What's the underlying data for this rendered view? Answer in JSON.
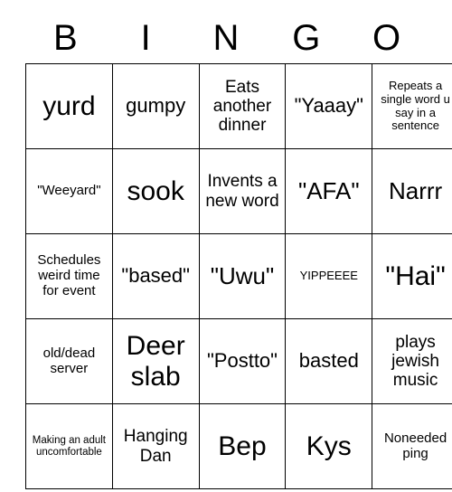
{
  "card": {
    "header_letters": [
      "B",
      "I",
      "N",
      "G",
      "O"
    ],
    "rows": [
      [
        {
          "text": "yurd",
          "size": "fs-xxl"
        },
        {
          "text": "gumpy",
          "size": "fs-lg"
        },
        {
          "text": "Eats another dinner",
          "size": "fs-md"
        },
        {
          "text": "\"Yaaay\"",
          "size": "fs-lg"
        },
        {
          "text": "Repeats a single word u say in a sentence",
          "size": "fs-xs"
        }
      ],
      [
        {
          "text": "\"Weeyard\"",
          "size": "fs-sm"
        },
        {
          "text": "sook",
          "size": "fs-xxl"
        },
        {
          "text": "Invents a new word",
          "size": "fs-md"
        },
        {
          "text": "\"AFA\"",
          "size": "fs-xl"
        },
        {
          "text": "Narrr",
          "size": "fs-xl"
        }
      ],
      [
        {
          "text": "Schedules weird time for event",
          "size": "fs-sm"
        },
        {
          "text": "\"based\"",
          "size": "fs-lg"
        },
        {
          "text": "\"Uwu\"",
          "size": "fs-xl"
        },
        {
          "text": "YIPPEEEE",
          "size": "fs-xs"
        },
        {
          "text": "\"Hai\"",
          "size": "fs-xxl"
        }
      ],
      [
        {
          "text": "old/dead server",
          "size": "fs-sm"
        },
        {
          "text": "Deer slab",
          "size": "fs-xxl"
        },
        {
          "text": "\"Postto\"",
          "size": "fs-lg"
        },
        {
          "text": "basted",
          "size": "fs-lg"
        },
        {
          "text": "plays jewish music",
          "size": "fs-md"
        }
      ],
      [
        {
          "text": "Making an adult uncomfortable",
          "size": "fs-xxs"
        },
        {
          "text": "Hanging Dan",
          "size": "fs-md"
        },
        {
          "text": "Bep",
          "size": "fs-xxl"
        },
        {
          "text": "Kys",
          "size": "fs-xxl"
        },
        {
          "text": "Noneeded ping",
          "size": "fs-sm"
        }
      ]
    ]
  },
  "colors": {
    "grid_line": "#000000",
    "text": "#000000",
    "background": "#ffffff"
  }
}
